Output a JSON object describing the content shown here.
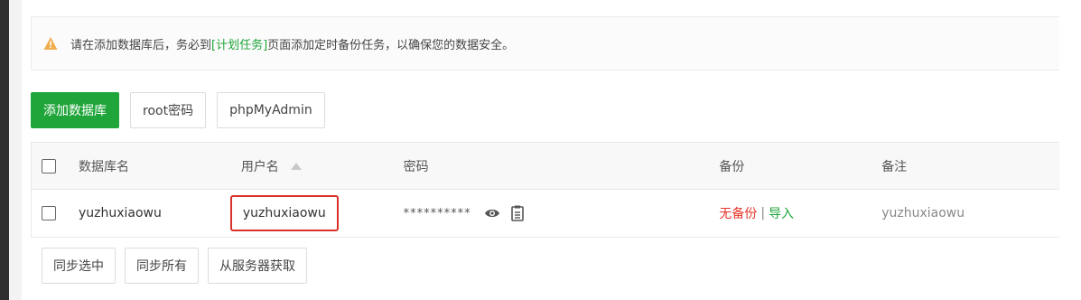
{
  "notice": {
    "text_before": "请在添加数据库后，务必到",
    "link": "[计划任务]",
    "text_after": "页面添加定时备份任务，以确保您的数据安全。",
    "icon": "warning-triangle-icon",
    "icon_color": "#f0ad4e"
  },
  "toolbar": {
    "add_db": "添加数据库",
    "root_pwd": "root密码",
    "phpmyadmin": "phpMyAdmin"
  },
  "table": {
    "headers": {
      "db_name": "数据库名",
      "username": "用户名",
      "password": "密码",
      "backup": "备份",
      "note": "备注"
    },
    "rows": [
      {
        "db_name": "yuzhuxiaowu",
        "username": "yuzhuxiaowu",
        "password": "**********",
        "backup_status": "无备份",
        "backup_sep": "|",
        "backup_import": "导入",
        "note": "yuzhuxiaowu"
      }
    ]
  },
  "bottom": {
    "sync_selected": "同步选中",
    "sync_all": "同步所有",
    "fetch_from_server": "从服务器获取"
  },
  "colors": {
    "primary": "#20a53a",
    "danger": "#e6352b",
    "highlight_border": "#d9302a"
  }
}
